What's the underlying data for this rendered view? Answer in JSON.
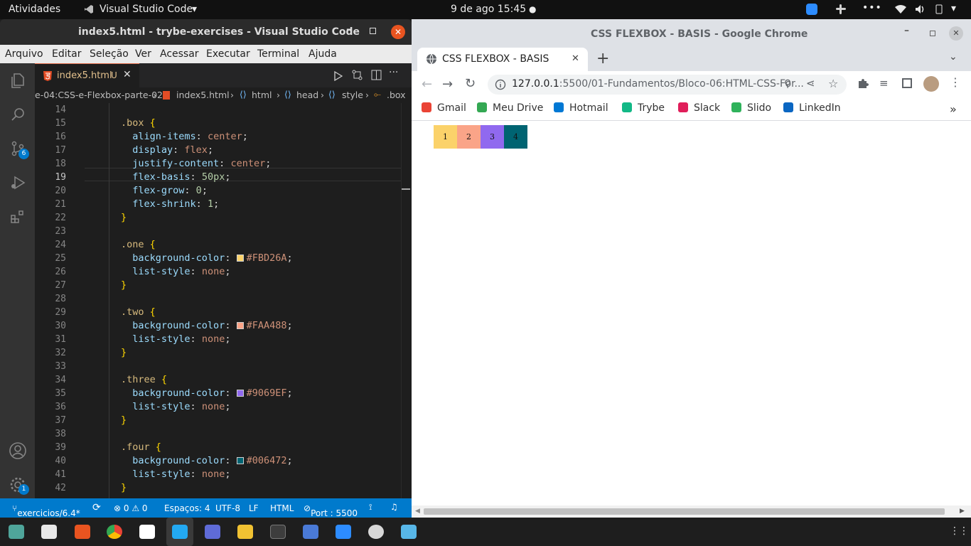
{
  "topbar": {
    "activities": "Atividades",
    "app_name": "Visual Studio Code",
    "app_arrow": "▾",
    "datetime": "9 de ago  15:45",
    "dot": "●"
  },
  "vscode": {
    "title": "index5.html - trybe-exercises - Visual Studio Code",
    "menu": [
      "Arquivo",
      "Editar",
      "Seleção",
      "Ver",
      "Acessar",
      "Executar",
      "Terminal",
      "Ajuda"
    ],
    "tab": {
      "name": "index5.html",
      "badge": "U"
    },
    "breadcrumb": [
      "e-04:CSS-e-Flexbox-parte-02",
      "index5.html",
      "html",
      "head",
      "style",
      ".box"
    ],
    "activity_badges": {
      "scm": "6",
      "accounts": "1"
    },
    "lines": [
      {
        "n": "14",
        "tokens": []
      },
      {
        "n": "15",
        "tokens": [
          {
            "c": "sel",
            "t": ".box "
          },
          {
            "c": "brace",
            "t": "{"
          }
        ]
      },
      {
        "n": "16",
        "tokens": [
          {
            "c": "prop",
            "t": "  align-items"
          },
          {
            "c": "punc",
            "t": ": "
          },
          {
            "c": "val",
            "t": "center"
          },
          {
            "c": "punc",
            "t": ";"
          }
        ]
      },
      {
        "n": "17",
        "tokens": [
          {
            "c": "prop",
            "t": "  display"
          },
          {
            "c": "punc",
            "t": ": "
          },
          {
            "c": "val",
            "t": "flex"
          },
          {
            "c": "punc",
            "t": ";"
          }
        ]
      },
      {
        "n": "18",
        "tokens": [
          {
            "c": "prop",
            "t": "  justify-content"
          },
          {
            "c": "punc",
            "t": ": "
          },
          {
            "c": "val",
            "t": "center"
          },
          {
            "c": "punc",
            "t": ";"
          }
        ]
      },
      {
        "n": "19",
        "tokens": [
          {
            "c": "prop",
            "t": "  flex-basis"
          },
          {
            "c": "punc",
            "t": ": "
          },
          {
            "c": "num",
            "t": "50px"
          },
          {
            "c": "punc",
            "t": ";"
          }
        ]
      },
      {
        "n": "20",
        "tokens": [
          {
            "c": "prop",
            "t": "  flex-grow"
          },
          {
            "c": "punc",
            "t": ": "
          },
          {
            "c": "num",
            "t": "0"
          },
          {
            "c": "punc",
            "t": ";"
          }
        ]
      },
      {
        "n": "21",
        "tokens": [
          {
            "c": "prop",
            "t": "  flex-shrink"
          },
          {
            "c": "punc",
            "t": ": "
          },
          {
            "c": "num",
            "t": "1"
          },
          {
            "c": "punc",
            "t": ";"
          }
        ]
      },
      {
        "n": "22",
        "tokens": [
          {
            "c": "brace",
            "t": "}"
          }
        ]
      },
      {
        "n": "23",
        "tokens": []
      },
      {
        "n": "24",
        "tokens": [
          {
            "c": "sel",
            "t": ".one "
          },
          {
            "c": "brace",
            "t": "{"
          }
        ]
      },
      {
        "n": "25",
        "tokens": [
          {
            "c": "prop",
            "t": "  background-color"
          },
          {
            "c": "punc",
            "t": ": "
          },
          {
            "c": "swatch",
            "t": "#FBD26A"
          },
          {
            "c": "val",
            "t": "#FBD26A"
          },
          {
            "c": "punc",
            "t": ";"
          }
        ]
      },
      {
        "n": "26",
        "tokens": [
          {
            "c": "prop",
            "t": "  list-style"
          },
          {
            "c": "punc",
            "t": ": "
          },
          {
            "c": "val",
            "t": "none"
          },
          {
            "c": "punc",
            "t": ";"
          }
        ]
      },
      {
        "n": "27",
        "tokens": [
          {
            "c": "brace",
            "t": "}"
          }
        ]
      },
      {
        "n": "28",
        "tokens": []
      },
      {
        "n": "29",
        "tokens": [
          {
            "c": "sel",
            "t": ".two "
          },
          {
            "c": "brace",
            "t": "{"
          }
        ]
      },
      {
        "n": "30",
        "tokens": [
          {
            "c": "prop",
            "t": "  background-color"
          },
          {
            "c": "punc",
            "t": ": "
          },
          {
            "c": "swatch",
            "t": "#FAA488"
          },
          {
            "c": "val",
            "t": "#FAA488"
          },
          {
            "c": "punc",
            "t": ";"
          }
        ]
      },
      {
        "n": "31",
        "tokens": [
          {
            "c": "prop",
            "t": "  list-style"
          },
          {
            "c": "punc",
            "t": ": "
          },
          {
            "c": "val",
            "t": "none"
          },
          {
            "c": "punc",
            "t": ";"
          }
        ]
      },
      {
        "n": "32",
        "tokens": [
          {
            "c": "brace",
            "t": "}"
          }
        ]
      },
      {
        "n": "33",
        "tokens": []
      },
      {
        "n": "34",
        "tokens": [
          {
            "c": "sel",
            "t": ".three "
          },
          {
            "c": "brace",
            "t": "{"
          }
        ]
      },
      {
        "n": "35",
        "tokens": [
          {
            "c": "prop",
            "t": "  background-color"
          },
          {
            "c": "punc",
            "t": ": "
          },
          {
            "c": "swatch",
            "t": "#9069EF"
          },
          {
            "c": "val",
            "t": "#9069EF"
          },
          {
            "c": "punc",
            "t": ";"
          }
        ]
      },
      {
        "n": "36",
        "tokens": [
          {
            "c": "prop",
            "t": "  list-style"
          },
          {
            "c": "punc",
            "t": ": "
          },
          {
            "c": "val",
            "t": "none"
          },
          {
            "c": "punc",
            "t": ";"
          }
        ]
      },
      {
        "n": "37",
        "tokens": [
          {
            "c": "brace",
            "t": "}"
          }
        ]
      },
      {
        "n": "38",
        "tokens": []
      },
      {
        "n": "39",
        "tokens": [
          {
            "c": "sel",
            "t": ".four "
          },
          {
            "c": "brace",
            "t": "{"
          }
        ]
      },
      {
        "n": "40",
        "tokens": [
          {
            "c": "prop",
            "t": "  background-color"
          },
          {
            "c": "punc",
            "t": ": "
          },
          {
            "c": "swatch",
            "t": "#006472"
          },
          {
            "c": "val",
            "t": "#006472"
          },
          {
            "c": "punc",
            "t": ";"
          }
        ]
      },
      {
        "n": "41",
        "tokens": [
          {
            "c": "prop",
            "t": "  list-style"
          },
          {
            "c": "punc",
            "t": ": "
          },
          {
            "c": "val",
            "t": "none"
          },
          {
            "c": "punc",
            "t": ";"
          }
        ]
      },
      {
        "n": "42",
        "tokens": [
          {
            "c": "brace",
            "t": "}"
          }
        ]
      }
    ],
    "status": {
      "branch": "exercicios/6.4*",
      "problems": "⊗ 0 ⚠ 0",
      "spaces": "Espaços: 4",
      "encoding": "UTF-8",
      "eol": "LF",
      "language": "HTML",
      "port": "Port : 5500"
    }
  },
  "chrome": {
    "title": "CSS FLEXBOX - BASIS - Google Chrome",
    "tab_title": "CSS FLEXBOX - BASIS",
    "url_host": "127.0.0.1",
    "url_rest": ":5500/01-Fundamentos/Bloco-06:HTML-CSS-For...",
    "bookmarks": [
      {
        "label": "Gmail",
        "color": "#ea4335"
      },
      {
        "label": "Meu Drive",
        "color": "#34a853"
      },
      {
        "label": "Hotmail",
        "color": "#0078d4"
      },
      {
        "label": "Trybe",
        "color": "#12b886"
      },
      {
        "label": "Slack",
        "color": "#e01e5a"
      },
      {
        "label": "Slido",
        "color": "#2fb25b"
      },
      {
        "label": "LinkedIn",
        "color": "#0a66c2"
      }
    ],
    "more_bookmarks": "»",
    "boxes": [
      {
        "label": "1",
        "color": "#FBD26A"
      },
      {
        "label": "2",
        "color": "#FAA488"
      },
      {
        "label": "3",
        "color": "#9069EF"
      },
      {
        "label": "4",
        "color": "#006472"
      }
    ]
  }
}
